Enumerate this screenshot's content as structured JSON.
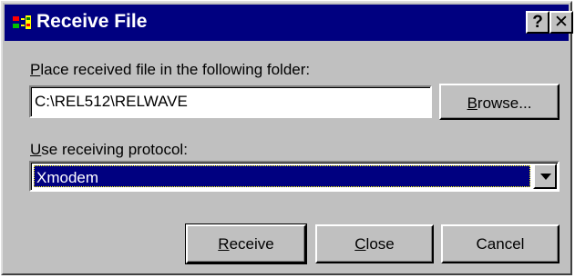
{
  "window": {
    "title": "Receive File",
    "help_label": "?",
    "close_label": "✕"
  },
  "folder": {
    "label_prefix": "",
    "label_accel": "P",
    "label_rest": "lace received file in the following folder:",
    "value": "C:\\REL512\\RELWAVE",
    "browse_accel": "B",
    "browse_rest": "rowse..."
  },
  "protocol": {
    "label_accel": "U",
    "label_rest": "se receiving protocol:",
    "selected": "Xmodem"
  },
  "buttons": {
    "receive_accel": "R",
    "receive_rest": "eceive",
    "close_accel": "C",
    "close_rest": "lose",
    "cancel_label": "Cancel"
  },
  "colors": {
    "titlebar": "#000080",
    "face": "#c0c0c0",
    "selection": "#000080"
  },
  "icons": {
    "app": "transfer-icon",
    "help": "help-icon",
    "close": "close-icon",
    "dropdown": "chevron-down-icon"
  }
}
